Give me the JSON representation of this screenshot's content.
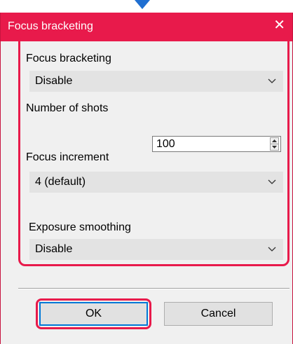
{
  "window": {
    "title": "Focus bracketing",
    "close_symbol": "✕"
  },
  "fields": {
    "focus_bracketing": {
      "label": "Focus bracketing",
      "value": "Disable"
    },
    "number_of_shots": {
      "label": "Number of shots",
      "value": "100"
    },
    "focus_increment": {
      "label": "Focus increment",
      "value": "4 (default)"
    },
    "exposure_smoothing": {
      "label": "Exposure smoothing",
      "value": "Disable"
    }
  },
  "buttons": {
    "ok": "OK",
    "cancel": "Cancel"
  },
  "colors": {
    "accent": "#e81a4b",
    "arrow": "#1f6fd1",
    "default_button_border": "#0078d7"
  },
  "icons": [
    "close-icon",
    "chevron-down-icon",
    "spin-up-icon",
    "spin-down-icon",
    "arrow-down-icon"
  ]
}
